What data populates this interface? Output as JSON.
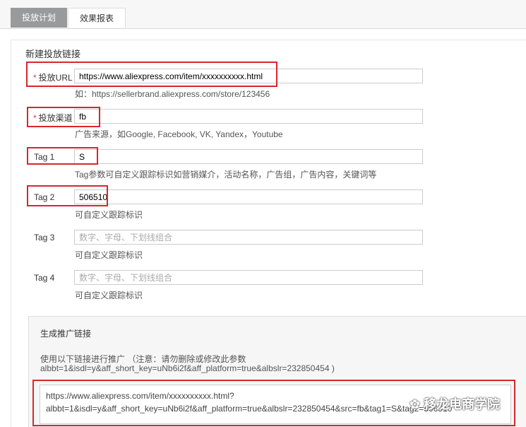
{
  "tabs": [
    {
      "label": "投放计划"
    },
    {
      "label": "效果报表"
    }
  ],
  "section_title": "新建投放链接",
  "fields": [
    {
      "required": true,
      "required_mark": "*",
      "label": "投放URL",
      "value": "https://www.aliexpress.com/item/xxxxxxxxxx.html",
      "placeholder": "",
      "hint": "如：https://sellerbrand.aliexpress.com/store/123456"
    },
    {
      "required": true,
      "required_mark": "*",
      "label": "投放渠道",
      "value": "fb",
      "placeholder": "",
      "hint": "广告来源，如Google, Facebook, VK, Yandex，Youtube"
    },
    {
      "required": false,
      "label": "Tag 1",
      "value": "S",
      "placeholder": "",
      "hint": "Tag参数可自定义跟踪标识如营销媒介，活动名称，广告组，广告内容，关键词等"
    },
    {
      "required": false,
      "label": "Tag 2",
      "value": "506510",
      "placeholder": "",
      "hint": "可自定义跟踪标识"
    },
    {
      "required": false,
      "label": "Tag 3",
      "value": "",
      "placeholder": "数字、字母、下划线组合",
      "hint": "可自定义跟踪标识"
    },
    {
      "required": false,
      "label": "Tag 4",
      "value": "",
      "placeholder": "数字、字母、下划线组合",
      "hint": "可自定义跟踪标识"
    }
  ],
  "generate": {
    "title": "生成推广链接",
    "hint": "使用以下链接进行推广        （注意：请勿删除或修改此参数",
    "hint_params": "albbt=1&isdl=y&aff_short_key=uNb6i2f&aff_platform=true&albslr=232850454 )",
    "output_line1": "https://www.aliexpress.com/item/xxxxxxxxxx.html?",
    "output_line2": "albbt=1&isdl=y&aff_short_key=uNb6i2f&aff_platform=true&albslr=232850454&src=fb&tag1=S&tag2=506510"
  },
  "watermark": "移龙电商学院",
  "colors": {
    "highlight": "#d9262c",
    "active_tab": "#999a9b"
  }
}
